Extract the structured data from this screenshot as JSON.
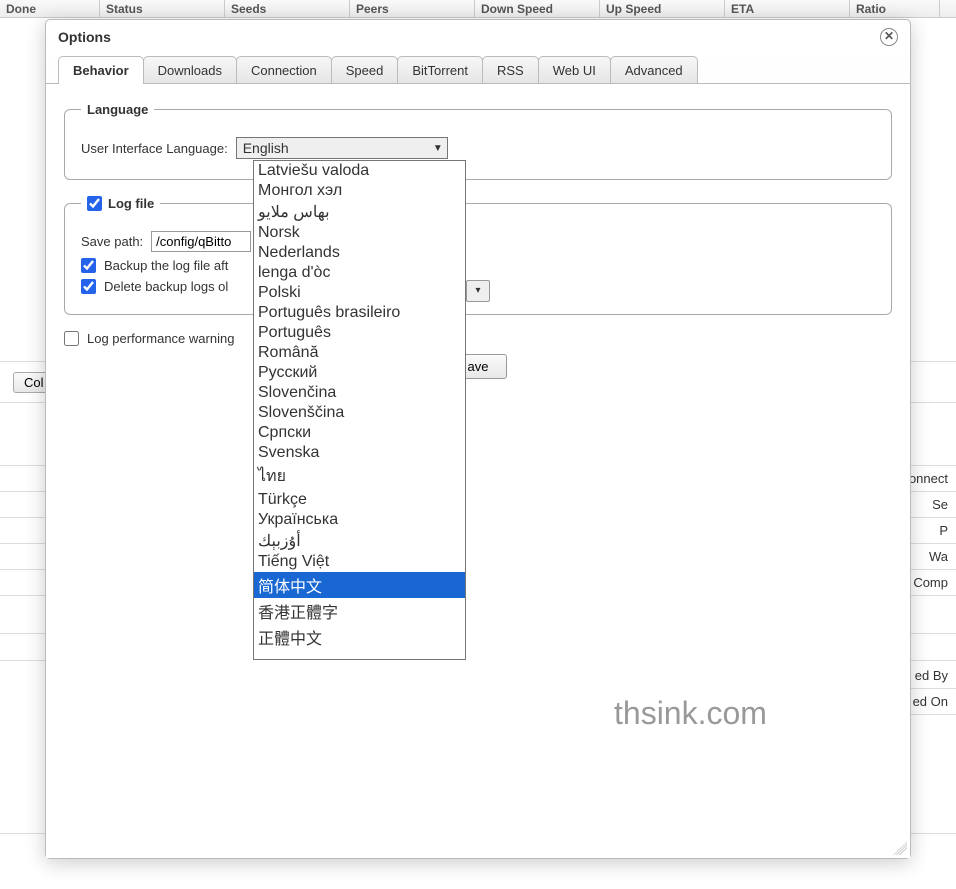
{
  "bg_columns": [
    "Done",
    "Status",
    "Seeds",
    "Peers",
    "Down Speed",
    "Up Speed",
    "ETA",
    "Ratio"
  ],
  "bg_side_labels": [
    "onnect",
    "Se",
    "P",
    "Wa",
    "Comp"
  ],
  "bg_side_labels2": [
    "ed By",
    "ed On"
  ],
  "collapse_label": "Col",
  "watermark": "thsink.com",
  "dialog": {
    "title": "Options",
    "tabs": [
      "Behavior",
      "Downloads",
      "Connection",
      "Speed",
      "BitTorrent",
      "RSS",
      "Web UI",
      "Advanced"
    ],
    "active_tab": "Behavior",
    "language": {
      "legend": "Language",
      "label": "User Interface Language:",
      "selected": "English"
    },
    "logfile": {
      "legend": "Log file",
      "enabled": true,
      "save_path_label": "Save path:",
      "save_path": "/config/qBitto",
      "backup_label": "Backup the log file aft",
      "backup_checked": true,
      "delete_label": "Delete backup logs ol",
      "delete_checked": true
    },
    "perf_warning": {
      "label": "Log performance warning",
      "checked": false
    },
    "save_label": "ave"
  },
  "language_options": [
    "Latviešu valoda",
    "Монгол хэл",
    "بهاس ملايو",
    "Norsk",
    "Nederlands",
    "lenga d'òc",
    "Polski",
    "Português brasileiro",
    "Português",
    "Română",
    "Русский",
    "Slovenčina",
    "Slovenščina",
    "Српски",
    "Svenska",
    "ไทย",
    "Türkçe",
    "Українська",
    "أۇزبېك",
    "Tiếng Việt",
    "简体中文",
    "香港正體字",
    "正體中文"
  ],
  "highlighted_option": "简体中文"
}
